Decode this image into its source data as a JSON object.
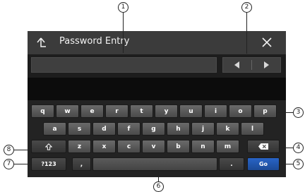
{
  "window": {
    "title": "Password Entry",
    "back_icon": "back-arrow-icon",
    "close_icon": "close-icon"
  },
  "input": {
    "value": "",
    "prev_icon": "left-triangle-icon",
    "next_icon": "right-triangle-icon"
  },
  "keyboard": {
    "row1": [
      "q",
      "w",
      "e",
      "r",
      "t",
      "y",
      "u",
      "i",
      "o",
      "p"
    ],
    "row2": [
      "a",
      "s",
      "d",
      "f",
      "g",
      "h",
      "j",
      "k",
      "l"
    ],
    "row3": [
      "z",
      "x",
      "c",
      "v",
      "b",
      "n",
      "m"
    ],
    "shift_icon": "shift-arrow-icon",
    "backspace_icon": "backspace-icon",
    "symbols_label": "?123",
    "comma_label": ",",
    "period_label": ".",
    "go_label": "Go",
    "space_label": ""
  },
  "callouts": [
    "1",
    "2",
    "3",
    "4",
    "5",
    "6",
    "7",
    "8"
  ],
  "colors": {
    "go_key": "#2864c6",
    "title_bar": "#3b3b3b",
    "keyboard_bg": "#232323"
  }
}
